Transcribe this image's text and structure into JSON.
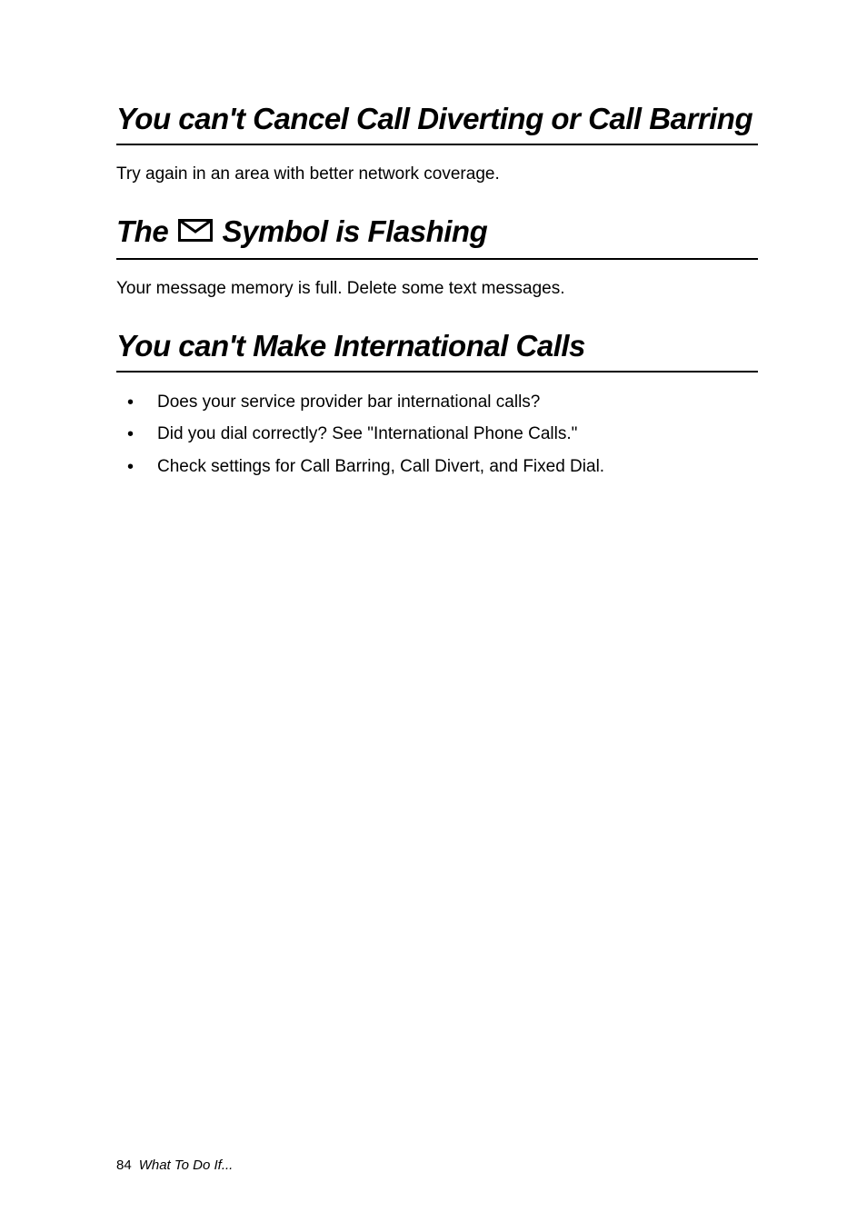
{
  "sections": [
    {
      "heading": "You can't Cancel Call Diverting or Call Barring",
      "body": "Try again in an area with better network coverage."
    },
    {
      "heading_prefix": "The ",
      "heading_suffix": " Symbol is Flashing",
      "icon": "envelope",
      "body": "Your message memory is full. Delete some text messages."
    },
    {
      "heading": "You can't Make International Calls",
      "bullets": [
        "Does your service provider bar international calls?",
        "Did you dial correctly? See \"International Phone Calls.\"",
        "Check settings for Call Barring, Call Divert, and Fixed Dial."
      ]
    }
  ],
  "footer": {
    "page_number": "84",
    "section_title": "What To Do If..."
  }
}
